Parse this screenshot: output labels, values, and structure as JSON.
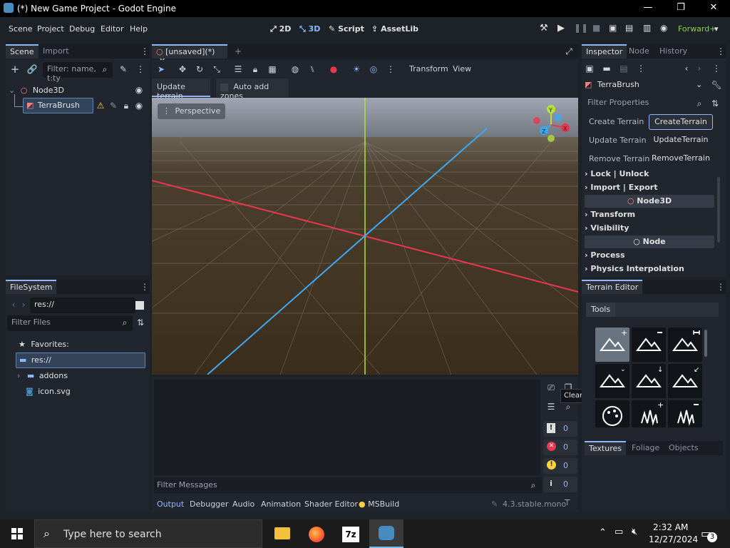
{
  "window": {
    "title": "(*) New Game Project - Godot Engine",
    "minimize": "—",
    "maximize": "❐",
    "close": "✕"
  },
  "menu": [
    "Scene",
    "Project",
    "Debug",
    "Editor",
    "Help"
  ],
  "workspaces": [
    {
      "label": "2D",
      "icon": "2d-icon"
    },
    {
      "label": "3D",
      "icon": "3d-icon"
    },
    {
      "label": "Script",
      "icon": "script-icon"
    },
    {
      "label": "AssetLib",
      "icon": "assetlib-icon"
    }
  ],
  "renderer": "Forward+",
  "scene_dock": {
    "tabs": [
      "Scene",
      "Import"
    ],
    "filter_placeholder": "Filter: name, t:ty",
    "nodes": [
      {
        "name": "Node3D"
      },
      {
        "name": "TerraBrush"
      }
    ]
  },
  "filesystem_dock": {
    "tab": "FileSystem",
    "path": "res://",
    "filter_placeholder": "Filter Files",
    "favorites_label": "Favorites:",
    "items": [
      "res://",
      "addons",
      "icon.svg"
    ]
  },
  "editor": {
    "scene_tab": "[unsaved](*)",
    "toolbar_text": [
      "Transform",
      "View"
    ],
    "terrain_toolbar": {
      "update_terrain": "Update terrain",
      "auto_add_zones": "Auto add zones"
    },
    "viewport_label": "Perspective",
    "gizmo_axes": [
      "Y",
      "Z",
      "X"
    ]
  },
  "output_panel": {
    "filter_placeholder": "Filter Messages",
    "tooltip": "Clear Output (Ctrl+Alt+K)",
    "counters": [
      {
        "icon": "error-icon",
        "value": "0"
      },
      {
        "icon": "error-circle-icon",
        "value": "0"
      },
      {
        "icon": "warning-icon",
        "value": "0"
      },
      {
        "icon": "info-icon",
        "value": "0"
      }
    ],
    "bottom_tabs": [
      "Output",
      "Debugger",
      "Audio",
      "Animation",
      "Shader Editor",
      "MSBuild"
    ],
    "version": "4.3.stable.mono"
  },
  "inspector": {
    "tabs": [
      "Inspector",
      "Node",
      "History"
    ],
    "object": "TerraBrush",
    "filter_placeholder": "Filter Properties",
    "properties": [
      {
        "label": "Create Terrain",
        "button": "CreateTerrain"
      },
      {
        "label": "Update Terrain",
        "button": "UpdateTerrain"
      },
      {
        "label": "Remove Terrain",
        "button": "RemoveTerrain"
      }
    ],
    "sections": [
      "Lock | Unlock",
      "Import | Export"
    ],
    "node3d_header": "Node3D",
    "node3d_sections": [
      "Transform",
      "Visibility"
    ],
    "node_header": "Node",
    "node_sections": [
      "Process",
      "Physics Interpolation"
    ]
  },
  "terrain_editor": {
    "tab": "Terrain Editor",
    "tools_tab": "Tools",
    "bottom_tabs": [
      "Textures",
      "Foliage",
      "Objects"
    ]
  },
  "taskbar": {
    "search_placeholder": "Type here to search",
    "time": "2:32 AM",
    "date": "12/27/2024",
    "notifications": "3"
  },
  "colors": {
    "accent": "#8eb8ff",
    "x_axis": "#e8384f",
    "y_axis": "#b4e03a",
    "z_axis": "#3da8f5",
    "node3d": "#fc7f7f"
  }
}
